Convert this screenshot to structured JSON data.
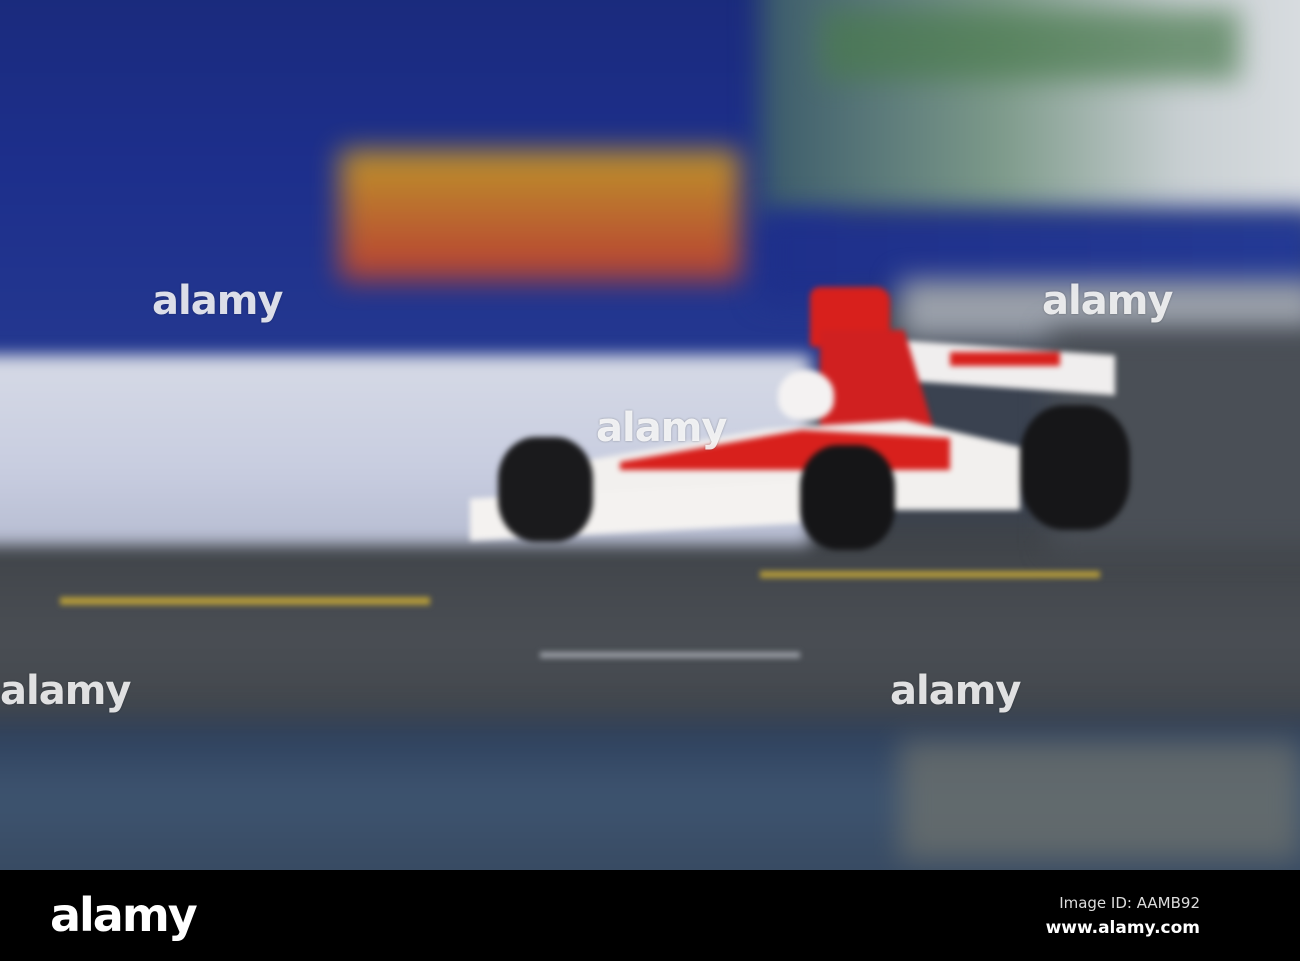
{
  "watermark": {
    "text": "alamy"
  },
  "footer": {
    "logo": "alamy",
    "image_id": "Image ID: AAMB92",
    "url": "www.alamy.com"
  },
  "colors": {
    "car_red": "#d8201c",
    "car_white": "#f2f0ee",
    "wall_blue": "#1c2e80"
  }
}
